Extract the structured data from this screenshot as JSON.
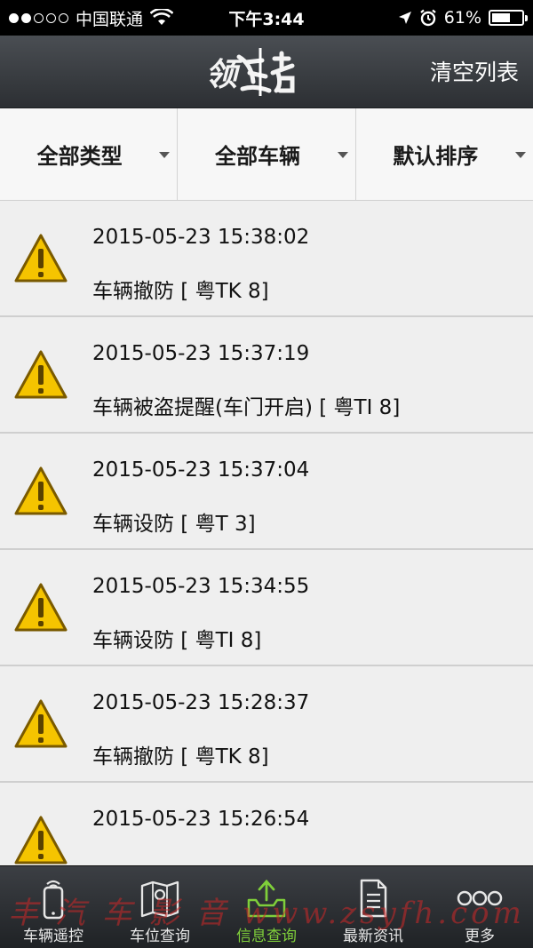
{
  "status_bar": {
    "carrier": "中国联通",
    "time": "下午3:44",
    "battery": "61%",
    "battery_level": 0.61
  },
  "navbar": {
    "logo_text": "领",
    "clear_label": "清空列表"
  },
  "filters": [
    {
      "label": "全部类型"
    },
    {
      "label": "全部车辆"
    },
    {
      "label": "默认排序"
    }
  ],
  "alerts": [
    {
      "time": "2015-05-23 15:38:02",
      "message": "车辆撤防 [  粤TK    8]"
    },
    {
      "time": "2015-05-23 15:37:19",
      "message": "车辆被盗提醒(车门开启) [  粤TI     8]"
    },
    {
      "time": "2015-05-23 15:37:04",
      "message": "车辆设防 [  粤T     3]"
    },
    {
      "time": "2015-05-23 15:34:55",
      "message": "车辆设防 [  粤TI     8]"
    },
    {
      "time": "2015-05-23 15:28:37",
      "message": "车辆撤防 [  粤TK    8]"
    },
    {
      "time": "2015-05-23 15:26:54",
      "message": ""
    }
  ],
  "tabs": [
    {
      "label": "车辆遥控",
      "icon": "phone-remote-icon"
    },
    {
      "label": "车位查询",
      "icon": "map-icon"
    },
    {
      "label": "信息查询",
      "icon": "inbox-upload-icon"
    },
    {
      "label": "最新资讯",
      "icon": "document-icon"
    },
    {
      "label": "更多",
      "icon": "more-icon"
    }
  ],
  "watermark": "丰 汽 车 影 音 www.zsyfh.com",
  "colors": {
    "active_tab": "#7fcf3a",
    "warning_yellow": "#f5c400"
  }
}
